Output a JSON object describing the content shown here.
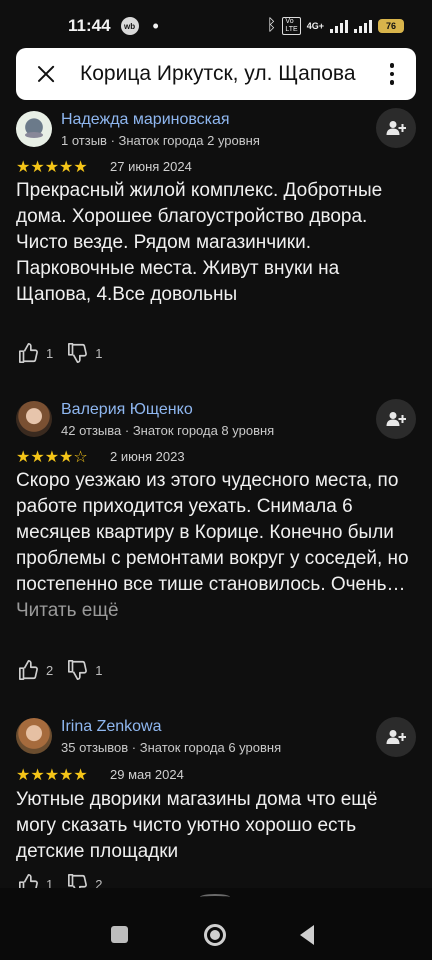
{
  "status_bar": {
    "time": "11:44",
    "app_badge": "wb",
    "dot": "•",
    "net_label": "4G+",
    "battery": "76"
  },
  "search": {
    "value": "Корица Иркутск, ул. Щапова"
  },
  "reviews": [
    {
      "author": "Надежда мариновская",
      "meta": "1 отзыв · Знаток города 2 уровня",
      "stars": "★★★★★",
      "date": "27 июня 2024",
      "text": "Прекрасный жилой комплекс. Добротные дома. Хорошее благоустройство двора. Чисто везде. Рядом магазинчики. Парковочные места. Живут внуки на Щапова, 4.Все довольны",
      "read_more": "",
      "likes": "1",
      "dislikes": "1"
    },
    {
      "author": "Валерия Ющенко",
      "meta": "42 отзыва · Знаток города 8 уровня",
      "stars": "★★★★☆",
      "date": "2 июня 2023",
      "text": "Скоро уезжаю из этого чудесного места, по работе приходится уехать. Снимала 6 месяцев квартиру в Корице. Конечно были проблемы с ремонтами вокруг у соседей, но постепенно все тише становилось. Очень…",
      "read_more": "Читать ещё",
      "likes": "2",
      "dislikes": "1"
    },
    {
      "author": "Irina Zenkowa",
      "meta": "35 отзывов · Знаток города 6 уровня",
      "stars": "★★★★★",
      "date": "29 мая 2024",
      "text": "Уютные дворики магазины дома что ещё могу сказать чисто уютно хорошо есть детские площадки",
      "read_more": "",
      "likes": "1",
      "dislikes": "2"
    }
  ],
  "colors": {
    "background": "#0f0f0f",
    "author_link": "#8fb7f0",
    "star": "#f5c518"
  }
}
